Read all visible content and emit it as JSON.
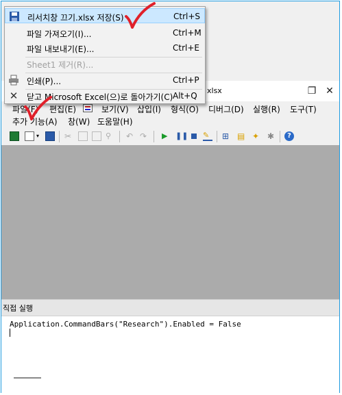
{
  "window": {
    "title": "xlsx"
  },
  "menubar": {
    "row1": [
      "파일(F)",
      "편집(E)",
      "보기(V)",
      "삽입(I)",
      "형식(O)",
      "디버그(D)",
      "실행(R)",
      "도구(T)"
    ],
    "row2": [
      "추가 기능(A)",
      "창(W)",
      "도움말(H)"
    ]
  },
  "file_menu": {
    "items": [
      {
        "label": "리서치창 끄기.xlsx 저장(S)",
        "shortcut": "Ctrl+S",
        "icon": "save-icon",
        "highlighted": true
      },
      {
        "label": "파일 가져오기(I)...",
        "shortcut": "Ctrl+M",
        "icon": ""
      },
      {
        "label": "파일 내보내기(E)...",
        "shortcut": "Ctrl+E",
        "icon": ""
      },
      {
        "label": "Sheet1 제거(R)...",
        "shortcut": "",
        "icon": "",
        "disabled": true
      },
      {
        "label": "인쇄(P)...",
        "shortcut": "Ctrl+P",
        "icon": "print-icon"
      },
      {
        "label": "닫고 Microsoft Excel(으)로 돌아가기(C)",
        "shortcut": "Alt+Q",
        "icon": "close-icon"
      }
    ]
  },
  "immediate": {
    "title": "직접 실행",
    "code": "Application.CommandBars(\"Research\").Enabled = False"
  },
  "colors": {
    "highlight": "#cce8ff",
    "checkmark": "#e0202a",
    "frame": "#1e9be0"
  }
}
